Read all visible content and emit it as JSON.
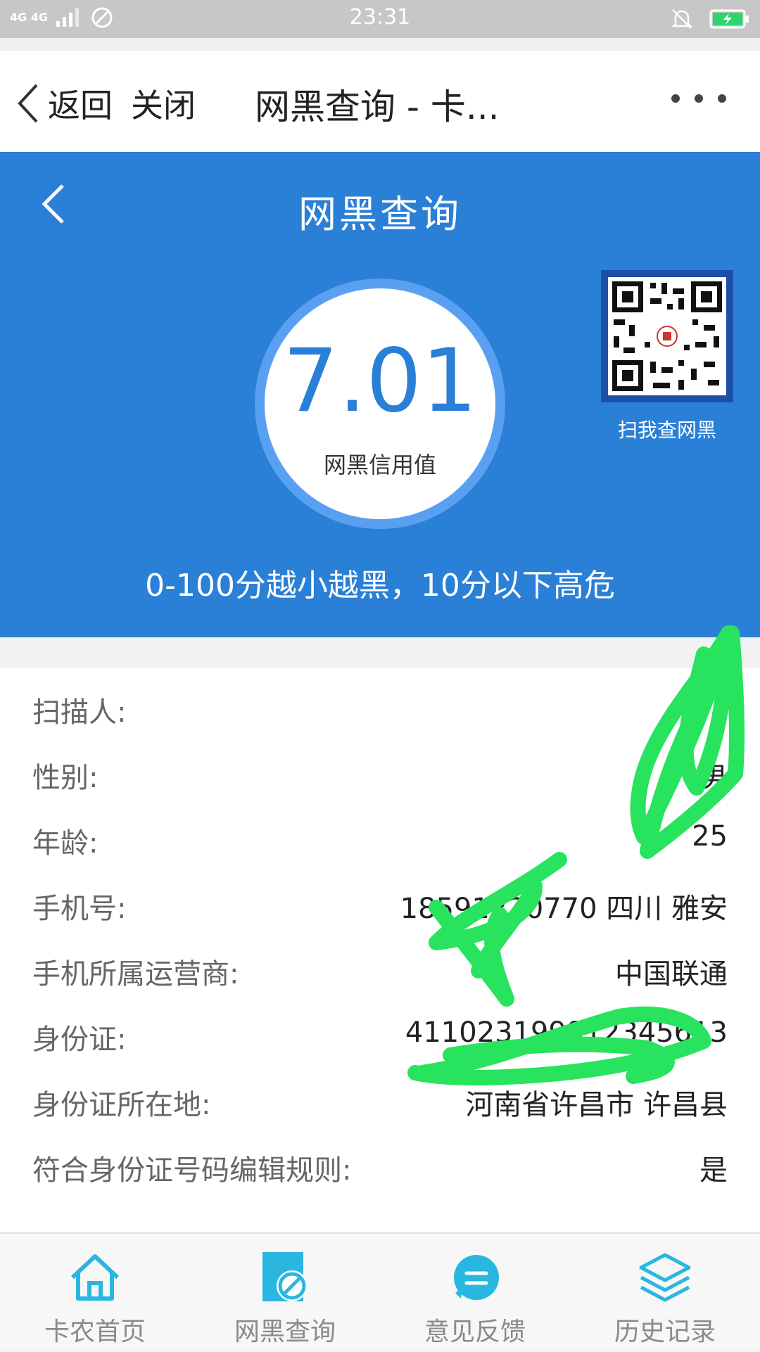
{
  "status_bar": {
    "network": "4G 4G",
    "time": "23:31"
  },
  "browser": {
    "back_label": "返回",
    "close_label": "关闭",
    "title": "网黑查询 - 卡..."
  },
  "hero": {
    "title": "网黑查询",
    "score": "7.01",
    "score_label": "网黑信用值",
    "qr_label": "扫我查网黑",
    "note": "0-100分越小越黑，10分以下高危",
    "colors": {
      "primary": "#2a7fd6",
      "ring": "#5aa0f2"
    }
  },
  "info": {
    "rows": [
      {
        "label": "扫描人:",
        "value": ""
      },
      {
        "label": "性别:",
        "value": "男"
      },
      {
        "label": "年龄:",
        "value": "25"
      },
      {
        "label": "手机号:",
        "value": "18591220770 四川 雅安"
      },
      {
        "label": "手机所属运营商:",
        "value": "中国联通"
      },
      {
        "label": "身份证:",
        "value": "411023199912345613"
      },
      {
        "label": "身份证所在地:",
        "value": "河南省许昌市 许昌县"
      },
      {
        "label": "符合身份证号码编辑规则:",
        "value": "是"
      }
    ]
  },
  "tabs": [
    {
      "label": "卡农首页",
      "icon": "home-icon"
    },
    {
      "label": "网黑查询",
      "icon": "blacklist-query-icon"
    },
    {
      "label": "意见反馈",
      "icon": "feedback-icon"
    },
    {
      "label": "历史记录",
      "icon": "history-layers-icon"
    }
  ],
  "tab_color": "#29b6e0",
  "scribble_color": "#27e35d"
}
